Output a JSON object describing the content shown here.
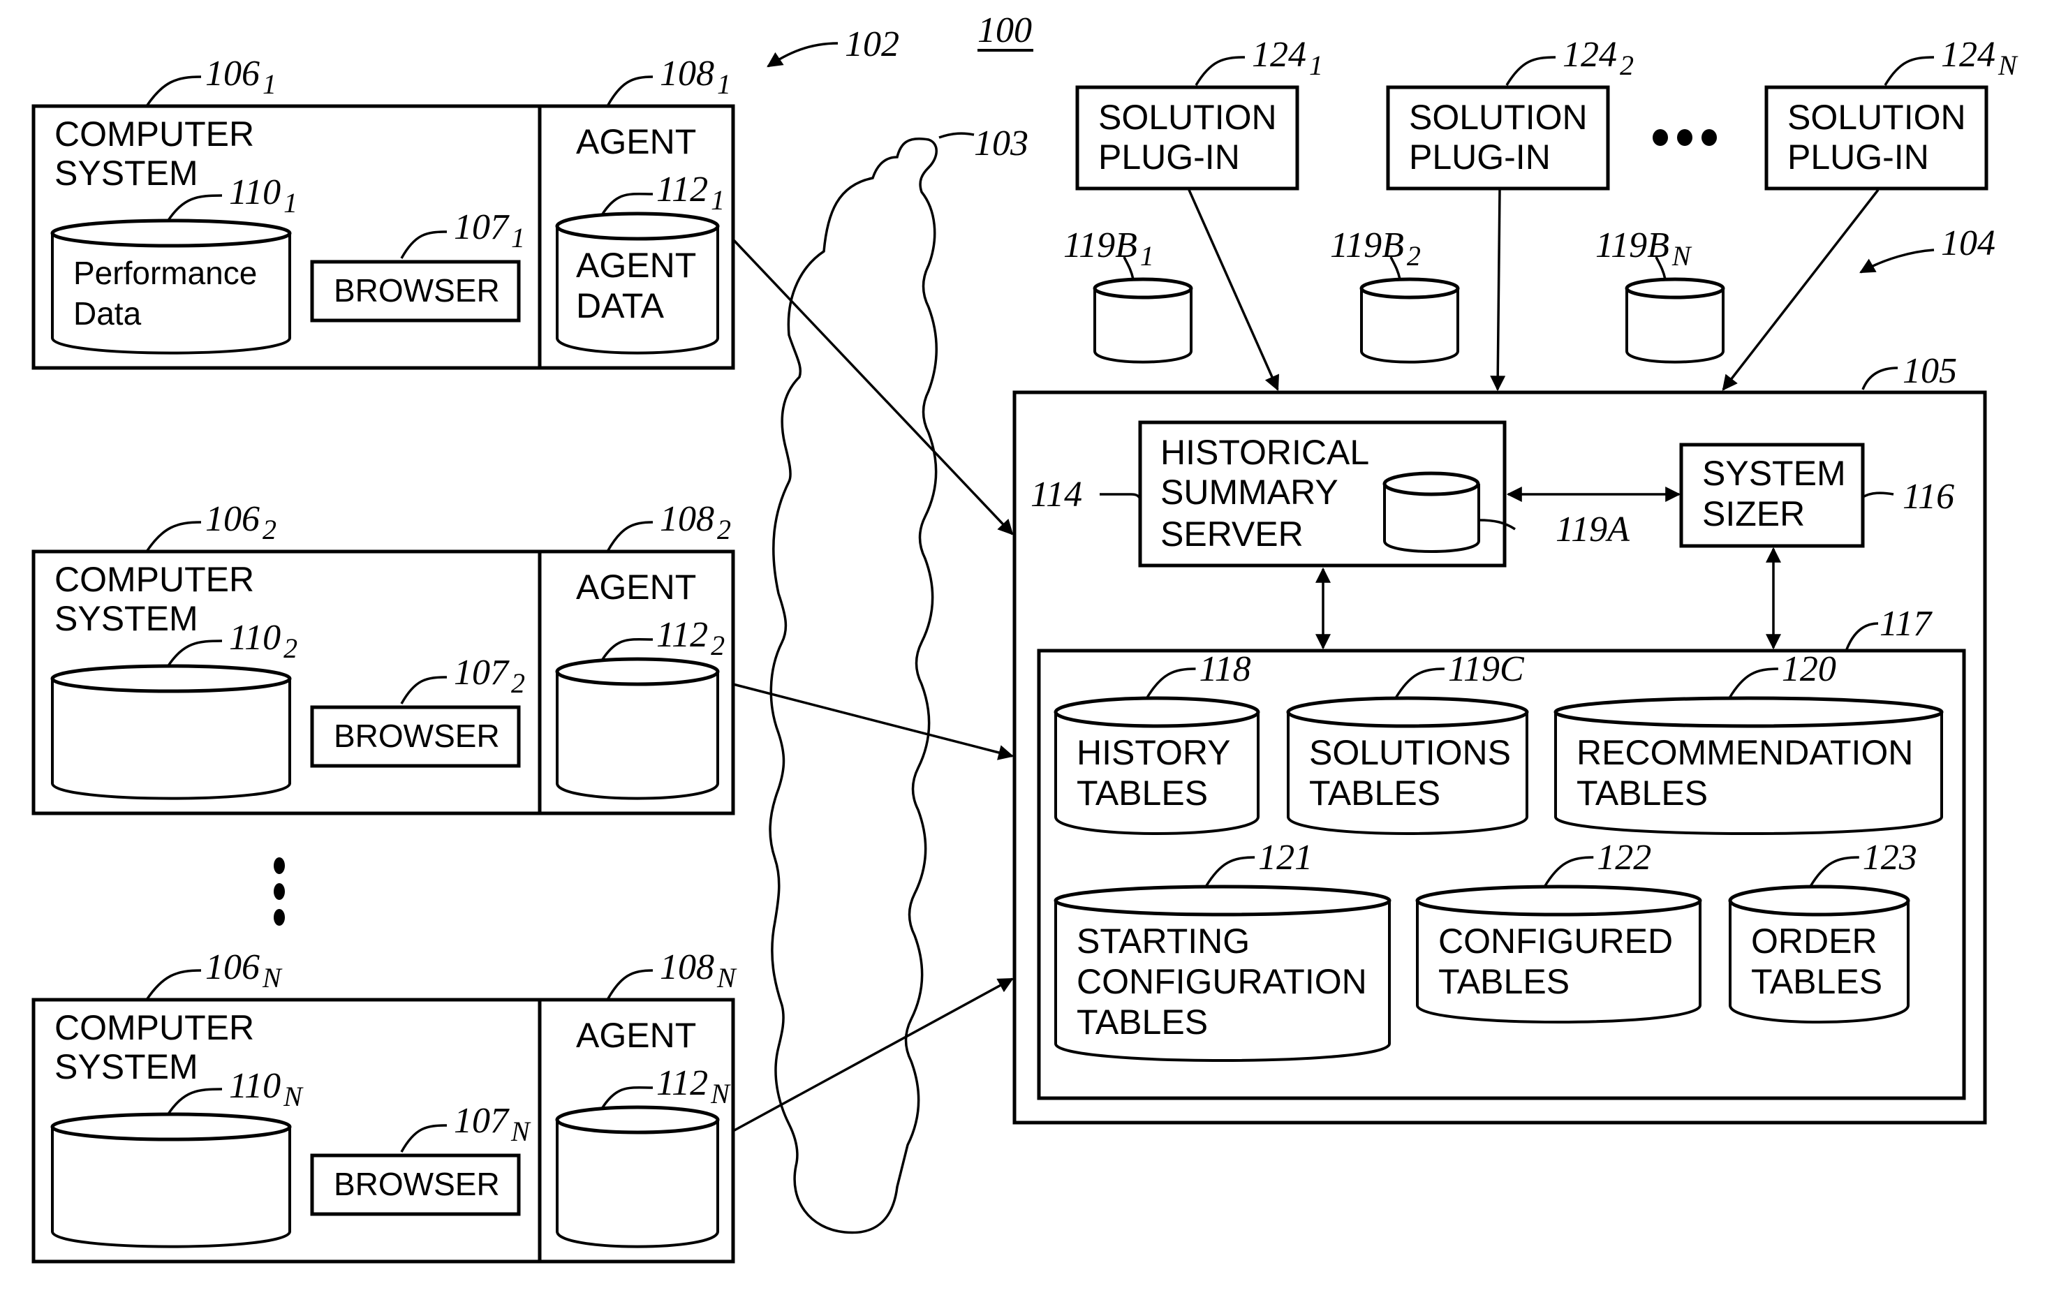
{
  "figure": {
    "number": "100",
    "computer_group_ref": "102",
    "network_ref": "103",
    "server_group_ref": "104",
    "server_ref": "105"
  },
  "computer_systems": [
    {
      "ref": "106",
      "sub": "1",
      "title1": "COMPUTER",
      "title2": "SYSTEM",
      "db_ref": "110",
      "db_sub": "1",
      "db_label1": "Performance",
      "db_label2": "Data",
      "browser_ref": "107",
      "browser_sub": "1",
      "browser_label": "BROWSER",
      "agent_ref": "108",
      "agent_sub": "1",
      "agent_label": "AGENT",
      "agent_db_ref": "112",
      "agent_db_sub": "1",
      "agent_db_label1": "AGENT",
      "agent_db_label2": "DATA"
    },
    {
      "ref": "106",
      "sub": "2",
      "title1": "COMPUTER",
      "title2": "SYSTEM",
      "db_ref": "110",
      "db_sub": "2",
      "db_label1": "",
      "db_label2": "",
      "browser_ref": "107",
      "browser_sub": "2",
      "browser_label": "BROWSER",
      "agent_ref": "108",
      "agent_sub": "2",
      "agent_label": "AGENT",
      "agent_db_ref": "112",
      "agent_db_sub": "2",
      "agent_db_label1": "",
      "agent_db_label2": ""
    },
    {
      "ref": "106",
      "sub": "N",
      "title1": "COMPUTER",
      "title2": "SYSTEM",
      "db_ref": "110",
      "db_sub": "N",
      "db_label1": "",
      "db_label2": "",
      "browser_ref": "107",
      "browser_sub": "N",
      "browser_label": "BROWSER",
      "agent_ref": "108",
      "agent_sub": "N",
      "agent_label": "AGENT",
      "agent_db_ref": "112",
      "agent_db_sub": "N",
      "agent_db_label1": "",
      "agent_db_label2": ""
    }
  ],
  "plugins": [
    {
      "ref": "124",
      "sub": "1",
      "label1": "SOLUTION",
      "label2": "PLUG-IN",
      "db_ref": "119B",
      "db_sub": "1"
    },
    {
      "ref": "124",
      "sub": "2",
      "label1": "SOLUTION",
      "label2": "PLUG-IN",
      "db_ref": "119B",
      "db_sub": "2"
    },
    {
      "ref": "124",
      "sub": "N",
      "label1": "SOLUTION",
      "label2": "PLUG-IN",
      "db_ref": "119B",
      "db_sub": "N"
    }
  ],
  "historical_server": {
    "ref": "114",
    "label1": "HISTORICAL",
    "label2": "SUMMARY",
    "label3": "SERVER",
    "db_ref": "119A"
  },
  "system_sizer": {
    "ref": "116",
    "label1": "SYSTEM",
    "label2": "SIZER"
  },
  "database": {
    "ref": "117",
    "tables": [
      {
        "ref": "118",
        "label1": "HISTORY",
        "label2": "TABLES",
        "label3": ""
      },
      {
        "ref": "119C",
        "label1": "SOLUTIONS",
        "label2": "TABLES",
        "label3": ""
      },
      {
        "ref": "120",
        "label1": "RECOMMENDATION",
        "label2": "TABLES",
        "label3": ""
      },
      {
        "ref": "121",
        "label1": "STARTING",
        "label2": "CONFIGURATION",
        "label3": "TABLES"
      },
      {
        "ref": "122",
        "label1": "CONFIGURED",
        "label2": "TABLES",
        "label3": ""
      },
      {
        "ref": "123",
        "label1": "ORDER",
        "label2": "TABLES",
        "label3": ""
      }
    ]
  }
}
